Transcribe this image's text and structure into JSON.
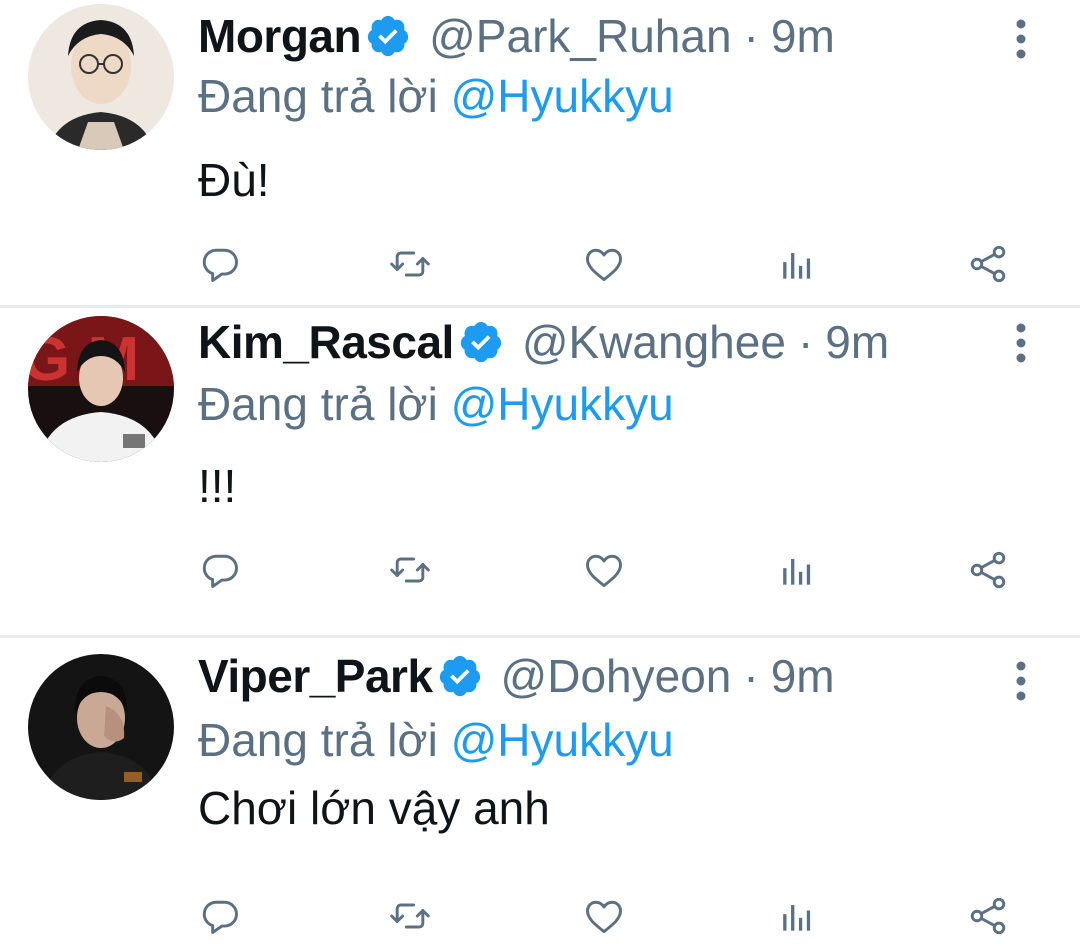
{
  "colors": {
    "text": "#0f1419",
    "secondary": "#5b7083",
    "accent": "#1d9bf0",
    "verified": "#1d9bf0",
    "divider": "#e6ecf0"
  },
  "reply_prefix": "Đang trả lời",
  "tweets": [
    {
      "name": "Morgan",
      "handle": "@Park_Ruhan",
      "separator": "·",
      "time": "9m",
      "reply_to": "@Hyukkyu",
      "text": "Đù!",
      "avatar": "profile-photo-glasses",
      "verified": true
    },
    {
      "name": "Kim_Rascal",
      "handle": "@Kwanghee",
      "separator": "·",
      "time": "9m",
      "reply_to": "@Hyukkyu",
      "text": "!!!",
      "avatar": "profile-photo-stage",
      "verified": true
    },
    {
      "name": "Viper_Park",
      "handle": "@Dohyeon",
      "separator": "·",
      "time": "9m",
      "reply_to": "@Hyukkyu",
      "text": "Chơi lớn vậy anh",
      "avatar": "profile-photo-dark",
      "verified": true
    }
  ],
  "action_icons": [
    "reply-icon",
    "retweet-icon",
    "like-icon",
    "stats-icon",
    "share-icon"
  ]
}
